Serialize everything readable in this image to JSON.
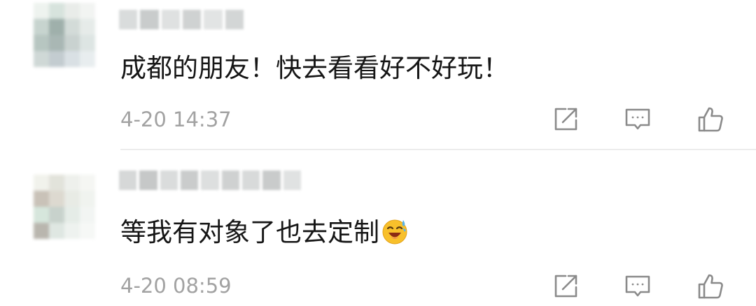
{
  "comments": [
    {
      "text": "成都的朋友！快去看看好不好玩！",
      "timestamp": "4-20 14:37"
    },
    {
      "text": "等我有对象了也去定制",
      "emoji": "laughing-sweat-emoji",
      "timestamp": "4-20 08:59"
    }
  ],
  "icons": {
    "share": "share-icon",
    "reply": "comment-icon",
    "like": "thumbs-up-icon"
  },
  "colors": {
    "text": "#161616",
    "timestamp": "#a2a2a2",
    "icon": "#8a8a8a",
    "divider": "#ececec"
  }
}
